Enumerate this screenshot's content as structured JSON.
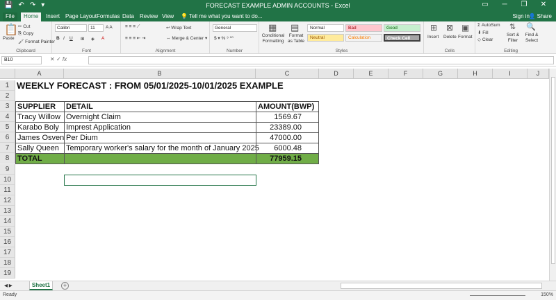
{
  "window": {
    "title": "FORECAST EXAMPLE ADMIN ACCOUNTS - Excel",
    "controls": [
      "▭",
      "─",
      "❐",
      "✕"
    ]
  },
  "qat": [
    "💾",
    "↶",
    "↷",
    "▾"
  ],
  "tabs": [
    {
      "label": "File"
    },
    {
      "label": "Home"
    },
    {
      "label": "Insert"
    },
    {
      "label": "Page Layout"
    },
    {
      "label": "Formulas"
    },
    {
      "label": "Data"
    },
    {
      "label": "Review"
    },
    {
      "label": "View"
    },
    {
      "label": "Tell me what you want to do..."
    }
  ],
  "account": {
    "signin": "Sign in",
    "share": "Share"
  },
  "ribbon": {
    "clipboard": {
      "label": "Clipboard",
      "paste": "Paste",
      "cut": "Cut",
      "copy": "Copy",
      "format_painter": "Format Painter"
    },
    "font": {
      "label": "Font",
      "name": "Calibri",
      "size": "11"
    },
    "alignment": {
      "label": "Alignment",
      "wrap": "Wrap Text",
      "merge": "Merge & Center"
    },
    "number": {
      "label": "Number",
      "format": "General"
    },
    "styles": {
      "label": "Styles",
      "conditional": "Conditional Formatting",
      "format_table": "Format as Table",
      "normal": "Normal",
      "bad": "Bad",
      "good": "Good",
      "neutral": "Neutral",
      "calculation": "Calculation",
      "check_cell": "Check Cell"
    },
    "cells": {
      "label": "Cells",
      "insert": "Insert",
      "delete": "Delete",
      "format": "Format"
    },
    "editing": {
      "label": "Editing",
      "autosum": "AutoSum",
      "fill": "Fill",
      "clear": "Clear",
      "sort": "Sort & Filter",
      "find": "Find & Select"
    }
  },
  "formula_bar": {
    "name_box": "B10",
    "fx": "fx",
    "value": ""
  },
  "columns": [
    "A",
    "B",
    "C",
    "D",
    "E",
    "F",
    "G",
    "H",
    "I",
    "J"
  ],
  "rows": [
    "1",
    "2",
    "3",
    "4",
    "5",
    "6",
    "7",
    "8",
    "9",
    "10",
    "11",
    "12",
    "13",
    "14",
    "15",
    "16",
    "17",
    "18",
    "19"
  ],
  "sheet": {
    "title": "WEEKLY FORECAST : FROM 05/01/2025-10/01/2025 EXAMPLE",
    "headers": {
      "supplier": "SUPPLIER",
      "detail": "DETAIL",
      "amount": "AMOUNT(BWP)"
    },
    "records": [
      {
        "supplier": "Tracy Willow",
        "detail": "Overnight Claim",
        "amount": "1569.67"
      },
      {
        "supplier": "Karabo Boly",
        "detail": "Imprest Application",
        "amount": "23389.00"
      },
      {
        "supplier": "James Osven",
        "detail": "Per Dium",
        "amount": "47000.00"
      },
      {
        "supplier": "Sally Queen",
        "detail": "Temporary worker's salary for the month of January 2025",
        "amount": "6000.48"
      }
    ],
    "total": {
      "label": "TOTAL",
      "amount": "77959.15"
    }
  },
  "sheet_tabs": [
    {
      "label": "Sheet1"
    }
  ],
  "status": {
    "ready": "Ready",
    "zoom": "150%"
  }
}
